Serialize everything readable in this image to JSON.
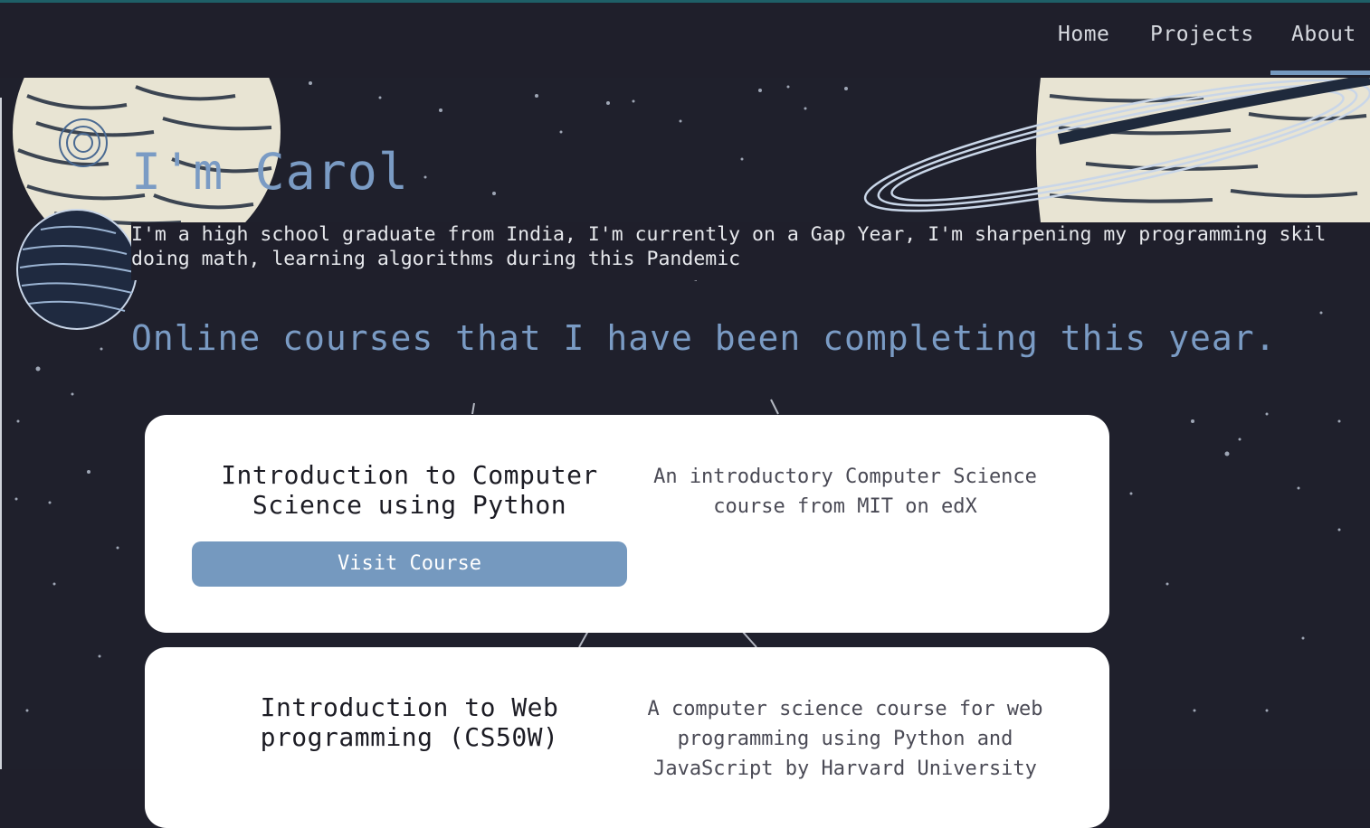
{
  "nav": {
    "items": [
      {
        "label": "Home"
      },
      {
        "label": "Projects"
      },
      {
        "label": "About"
      }
    ],
    "active": "About"
  },
  "hero": {
    "title": "I'm Carol",
    "description_line1": "I'm a high school graduate from India, I'm currently on a Gap Year, I'm sharpening my programming skil",
    "description_line2": "doing math, learning algorithms during this Pandemic"
  },
  "courses": {
    "heading": "Online courses that I have been completing this year.",
    "items": [
      {
        "title_line1": "Introduction to Computer",
        "title_line2": "Science using Python",
        "description_line1": "An introductory Computer Science",
        "description_line2": "course from MIT on edX",
        "button_label": "Visit Course"
      },
      {
        "title_line1": "Introduction to Web",
        "title_line2": "programming (CS50W)",
        "description_line1": "A computer science course for web",
        "description_line2": "programming using Python and",
        "description_line3": "JavaScript by Harvard University"
      }
    ]
  },
  "colors": {
    "background": "#1f1f2b",
    "accent": "#7599bf",
    "card": "#ffffff",
    "planet": "#e8e4d3"
  },
  "icons": [
    "planet-illustration",
    "ringed-planet-illustration",
    "striped-planet-illustration",
    "starfield"
  ]
}
